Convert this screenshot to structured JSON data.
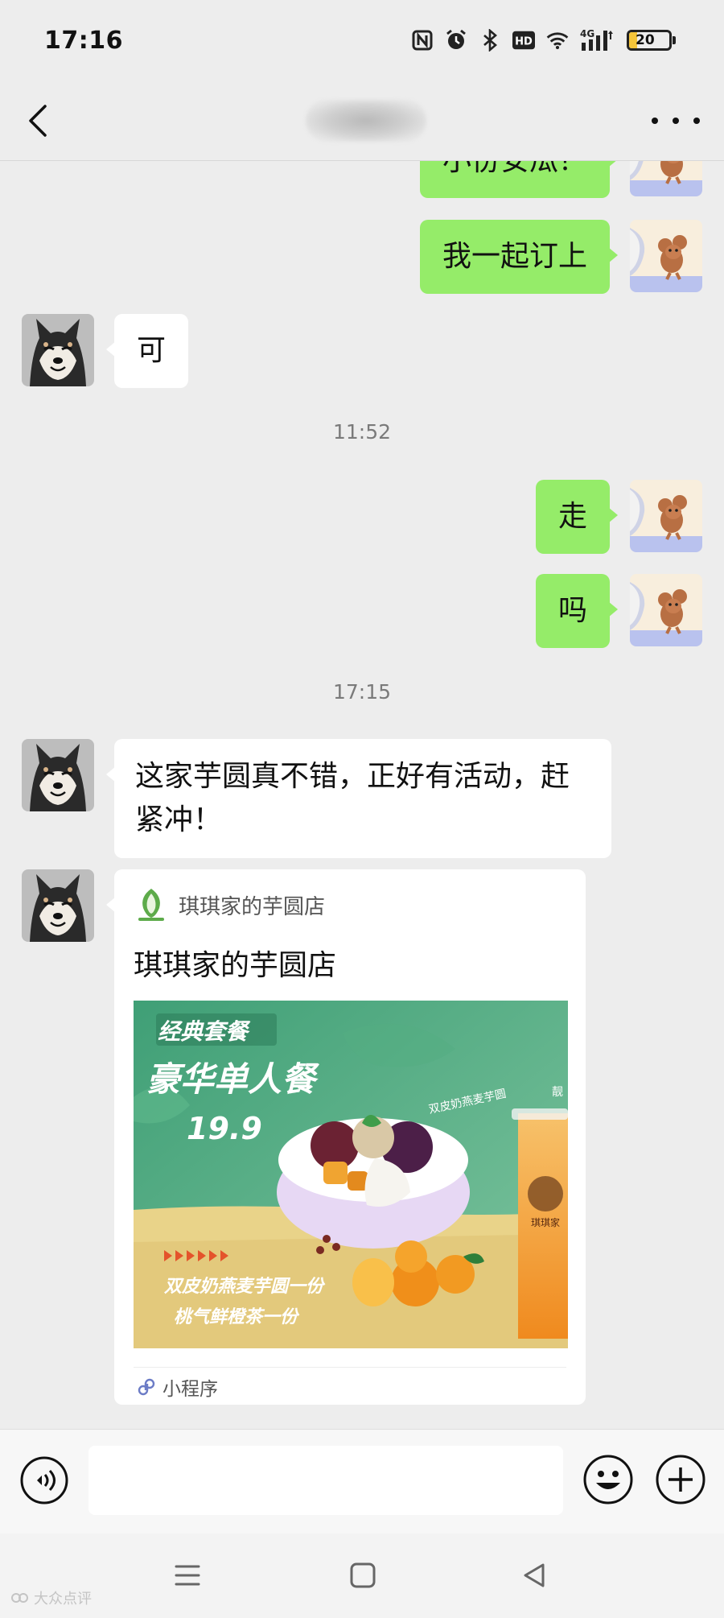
{
  "status_bar": {
    "time": "17:16",
    "network": "4G",
    "battery": "20",
    "battery_level": 0.2,
    "icons": [
      "nfc-icon",
      "alarm-icon",
      "bluetooth-icon",
      "hd-icon",
      "wifi-icon",
      "signal-icon",
      "battery-icon"
    ]
  },
  "header": {
    "contact_name": "",
    "back_icon": "chevron-left-icon",
    "more_icon": "more-dots-icon"
  },
  "messages": [
    {
      "side": "right",
      "text": "小份安瓜？",
      "partial": true
    },
    {
      "side": "right",
      "text": "我一起订上"
    },
    {
      "side": "left",
      "text": "可"
    },
    {
      "type": "timestamp",
      "text": "11:52"
    },
    {
      "side": "right",
      "text": "走"
    },
    {
      "side": "right",
      "text": "吗"
    },
    {
      "type": "timestamp",
      "text": "17:15"
    },
    {
      "side": "left",
      "text": "这家芋圆真不错，正好有活动，赶紧冲！"
    },
    {
      "side": "left",
      "type": "mini_program"
    }
  ],
  "mini_program": {
    "source_name": "琪琪家的芋圆店",
    "title": "琪琪家的芋圆店",
    "footer_label": "小程序",
    "poster": {
      "tag": "经典套餐",
      "headline": "豪华单人餐",
      "price": "19.9",
      "bowl_label": "双皮奶燕麦芋圆",
      "line1": "双皮奶燕麦芋圆一份",
      "line2": "桃气鲜橙茶一份",
      "side_text": "靓",
      "cup_label": "琪琪家"
    }
  },
  "input_bar": {
    "placeholder": "",
    "voice_icon": "voice-icon",
    "emoji_icon": "emoji-icon",
    "plus_icon": "plus-icon"
  },
  "system_nav": {
    "menu_icon": "menu-icon",
    "home_icon": "home-icon",
    "back_icon": "back-triangle-icon"
  },
  "watermark": "大众点评"
}
